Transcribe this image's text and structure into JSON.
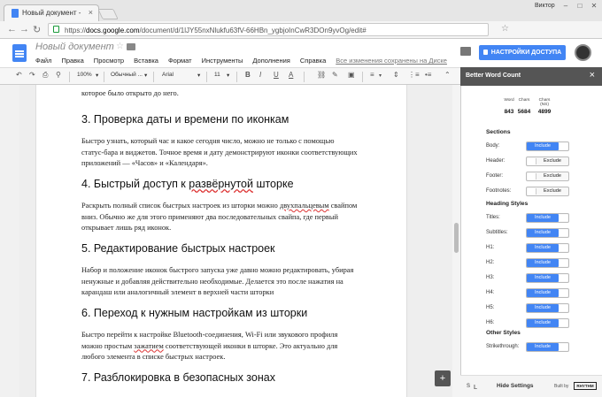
{
  "browser": {
    "tab_title": "Новый документ -",
    "tab_close": "×",
    "window_user": "Виктор",
    "min": "–",
    "max": "□",
    "close": "✕",
    "url_prefix": "https://",
    "url_host": "docs.google.com",
    "url_path": "/document/d/1lJY55nxNlukfu63fV-66HBn_ygbjoInCwR3DOn9yvOg/edit#",
    "back": "←",
    "forward": "→",
    "reload": "↻",
    "star": "☆"
  },
  "docs": {
    "title": "Новый документ",
    "title_star": "☆",
    "menu": [
      "Файл",
      "Правка",
      "Просмотр",
      "Вставка",
      "Формат",
      "Инструменты",
      "Дополнения",
      "Справка"
    ],
    "saved_status": "Все изменения сохранены на Диске",
    "share_label": "НАСТРОЙКИ ДОСТУПА"
  },
  "toolbar": {
    "undo": "↶",
    "redo": "↷",
    "print": "⎙",
    "paint": "⚲",
    "zoom": "100%",
    "style": "Обычный ...",
    "font": "Arial",
    "size": "11",
    "bold": "B",
    "italic": "I",
    "underline": "U",
    "color": "A",
    "link": "⛓",
    "comment": "✎",
    "image": "▣",
    "align": "≡",
    "spacing": "⇕",
    "numlist": "⋮≡",
    "bullets": "•≡",
    "pen": "✎",
    "collapse": "⌃",
    "caret": "▾"
  },
  "document": {
    "top_line": "которое было открыто до него.",
    "sections": [
      {
        "heading": "3. Проверка даты и времени по иконкам",
        "lines": [
          "Быстро узнать, который час и какое сегодня число, можно не только с помощью",
          "статус-бара и виджетов. Точное время и дату демонстрируют иконки соответствующих",
          "приложений — «Часов» и «Календаря»."
        ]
      },
      {
        "heading_a": "4. Быстрый доступ к ",
        "heading_b": "развёрнутой",
        "heading_c": " шторке",
        "line1_a": "Раскрыть полный список быстрых настроек из шторки можно ",
        "line1_b": "двухпальцевым",
        "line1_c": " свайпом",
        "lines": [
          "вниз. Обычно же для этого применяют два последовательных свайпа, где первый",
          "открывает лишь ряд иконок."
        ]
      },
      {
        "heading": "5. Редактирование быстрых настроек",
        "lines": [
          "Набор и положение иконок быстрого запуска уже давно можно редактировать, убирая",
          "ненужные и добавляя действительно необходимые. Делается это после нажатия на",
          "карандаш или аналогичный элемент в верхней части шторки"
        ]
      },
      {
        "heading": "6. Переход к нужным настройкам из шторки",
        "lines": [
          "Быстро перейти к настройке Bluetooth-соединения, Wi-Fi или звукового профиля"
        ],
        "line2_a": "можно простым ",
        "line2_b": "зажатием",
        "line2_c": " соответствующей иконки в шторке. Это актуально для",
        "line3": "любого элемента в списке быстрых настроек."
      },
      {
        "heading": "7. Разблокировка в безопасных зонах"
      }
    ],
    "explore": "+"
  },
  "sidebar": {
    "title": "Better Word Count",
    "close": "×",
    "counts": {
      "headers": [
        "Word",
        "Chars",
        "Chars (NS)"
      ],
      "values": [
        "843",
        "5684",
        "4899"
      ]
    },
    "sections_title": "Sections",
    "sections": [
      {
        "label": "Body:",
        "value": "Include"
      },
      {
        "label": "Header:",
        "value": "Exclude"
      },
      {
        "label": "Footer:",
        "value": "Exclude"
      },
      {
        "label": "Footnotes:",
        "value": "Exclude"
      }
    ],
    "heading_styles_title": "Heading Styles",
    "heading_styles": [
      {
        "label": "Titles:",
        "value": "Include"
      },
      {
        "label": "Subtitles:",
        "value": "Include"
      },
      {
        "label": "H1:",
        "value": "Include"
      },
      {
        "label": "H2:",
        "value": "Include"
      },
      {
        "label": "H3:",
        "value": "Include"
      },
      {
        "label": "H4:",
        "value": "Include"
      },
      {
        "label": "H5:",
        "value": "Include"
      },
      {
        "label": "H6:",
        "value": "Include"
      }
    ],
    "other_styles_title": "Other Styles",
    "other_styles": [
      {
        "label": "Strikethrough:",
        "value": "Include"
      }
    ],
    "footer": {
      "font_small": "S",
      "font_large": "L",
      "hide_settings": "Hide Settings",
      "built_by": "Built by",
      "logo": "RHYTHM"
    }
  }
}
